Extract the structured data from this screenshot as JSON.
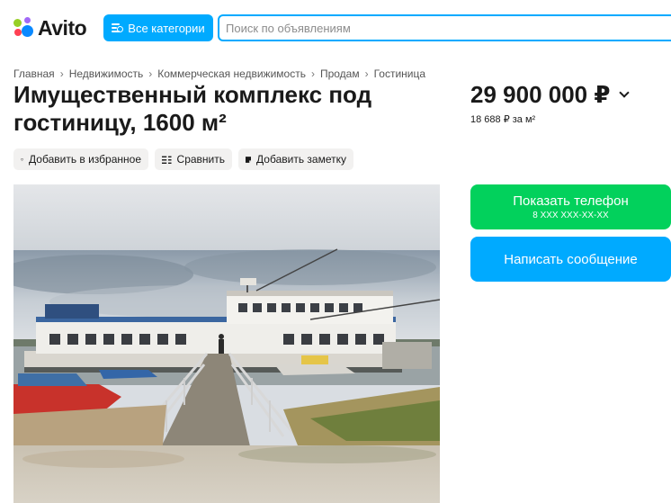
{
  "header": {
    "logo_text": "Avito",
    "categories_label": "Все категории",
    "search_placeholder": "Поиск по объявлениям",
    "accent_color": "#00aaff"
  },
  "breadcrumb": [
    "Главная",
    "Недвижимость",
    "Коммерческая недвижимость",
    "Продам",
    "Гостиница"
  ],
  "listing": {
    "title": "Имущественный комплекс под гостиницу, 1600 м²",
    "price": "29 900 000 ₽",
    "price_per_unit": "18 688 ₽ за м²"
  },
  "actions": {
    "favorite_label": "Добавить в избранное",
    "compare_label": "Сравнить",
    "note_label": "Добавить заметку"
  },
  "contact": {
    "show_phone_label": "Показать телефон",
    "phone_masked": "8 XXX XXX-XX-XX",
    "write_message_label": "Написать сообщение",
    "phone_button_color": "#02d15c",
    "message_button_color": "#00aaff"
  },
  "icons": [
    "heart-icon",
    "compare-icon",
    "note-icon",
    "categories-icon",
    "chevron-down-icon"
  ]
}
